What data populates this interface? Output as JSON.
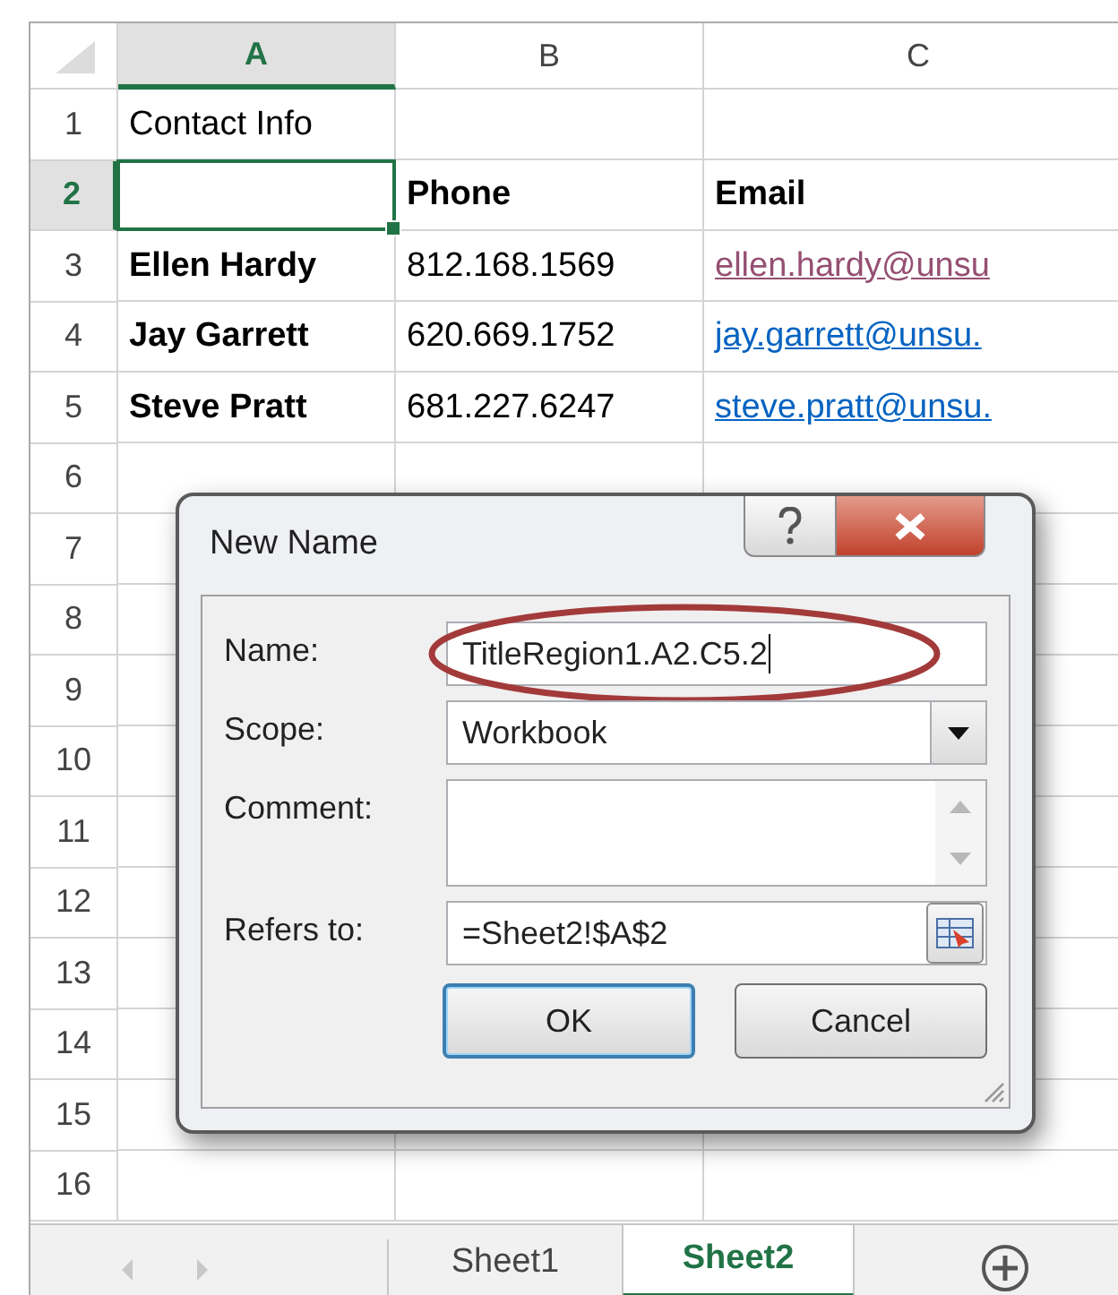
{
  "sheet": {
    "columns": [
      {
        "label": "A",
        "selected": true
      },
      {
        "label": "B",
        "selected": false
      },
      {
        "label": "C",
        "selected": false
      }
    ],
    "rows": [
      {
        "number": "1",
        "selected": false,
        "cells": [
          {
            "text": "Contact Info",
            "kind": "text"
          },
          {
            "text": "",
            "kind": "text"
          },
          {
            "text": "",
            "kind": "text"
          }
        ]
      },
      {
        "number": "2",
        "selected": true,
        "cells": [
          {
            "text": "",
            "kind": "active"
          },
          {
            "text": "Phone",
            "kind": "header"
          },
          {
            "text": "Email",
            "kind": "header"
          }
        ]
      },
      {
        "number": "3",
        "selected": false,
        "cells": [
          {
            "text": "Ellen Hardy",
            "kind": "header"
          },
          {
            "text": "812.168.1569",
            "kind": "text"
          },
          {
            "text": "ellen.hardy@unsu",
            "kind": "link",
            "visited": true
          }
        ]
      },
      {
        "number": "4",
        "selected": false,
        "cells": [
          {
            "text": "Jay Garrett",
            "kind": "header"
          },
          {
            "text": "620.669.1752",
            "kind": "text"
          },
          {
            "text": "jay.garrett@unsu.",
            "kind": "link",
            "visited": false
          }
        ]
      },
      {
        "number": "5",
        "selected": false,
        "cells": [
          {
            "text": "Steve Pratt",
            "kind": "header"
          },
          {
            "text": "681.227.6247",
            "kind": "text"
          },
          {
            "text": "steve.pratt@unsu.",
            "kind": "link",
            "visited": false
          }
        ]
      },
      {
        "number": "6",
        "selected": false
      },
      {
        "number": "7",
        "selected": false
      },
      {
        "number": "8",
        "selected": false
      },
      {
        "number": "9",
        "selected": false
      },
      {
        "number": "10",
        "selected": false
      },
      {
        "number": "11",
        "selected": false
      },
      {
        "number": "12",
        "selected": false
      },
      {
        "number": "13",
        "selected": false
      },
      {
        "number": "14",
        "selected": false
      },
      {
        "number": "15",
        "selected": false
      },
      {
        "number": "16",
        "selected": false
      }
    ],
    "tabs": [
      {
        "label": "Sheet1",
        "selected": false
      },
      {
        "label": "Sheet2",
        "selected": true
      }
    ]
  },
  "dialog": {
    "title": "New Name",
    "fields": [
      {
        "label": "Name:",
        "kind": "text",
        "value": "TitleRegion1.A2.C5.2",
        "highlighted": true
      },
      {
        "label": "Scope:",
        "kind": "dropdown",
        "value": "Workbook"
      },
      {
        "label": "Comment:",
        "kind": "textarea"
      },
      {
        "label": "Refers to:",
        "kind": "reference",
        "value": "=Sheet2!$A$2"
      }
    ],
    "buttons": [
      {
        "label": "OK",
        "default": true
      },
      {
        "label": "Cancel",
        "default": false
      }
    ]
  }
}
